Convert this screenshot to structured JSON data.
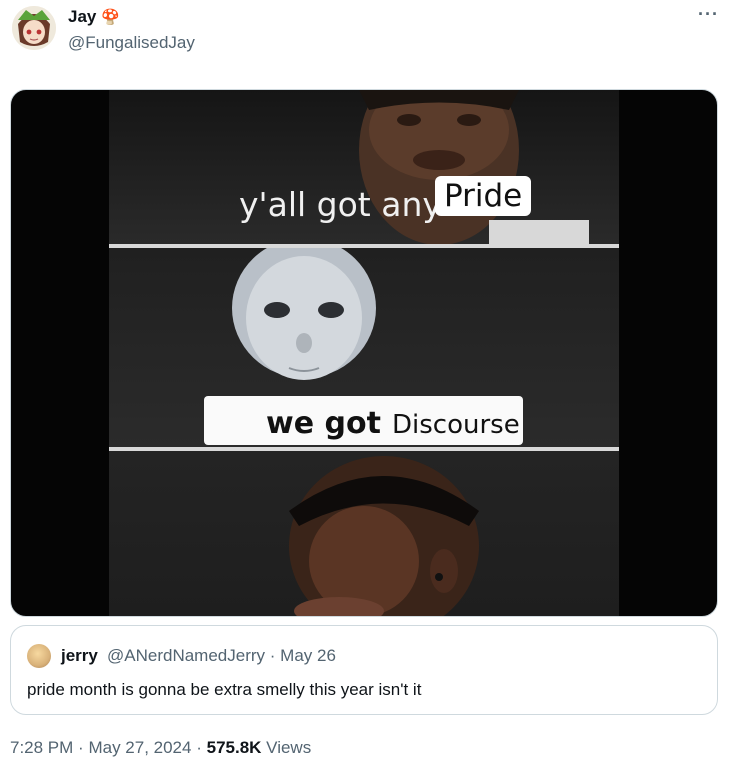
{
  "author": {
    "name": "Jay",
    "name_emoji": "🍄",
    "handle": "@FungalisedJay"
  },
  "more_label": "···",
  "meme": {
    "panel1_caption": "y'all got any",
    "panel1_highlight": "Pride",
    "panel2_bold": "we got",
    "panel2_rest": "Discourse"
  },
  "quoted_tweet": {
    "name": "jerry",
    "handle": "@ANerdNamedJerry",
    "dot": "·",
    "date": "May 26",
    "text": "pride month is gonna be extra smelly this year isn't it"
  },
  "meta": {
    "time": "7:28 PM",
    "sep": "·",
    "date": "May 27, 2024",
    "views_count": "575.8K",
    "views_label": "Views"
  }
}
